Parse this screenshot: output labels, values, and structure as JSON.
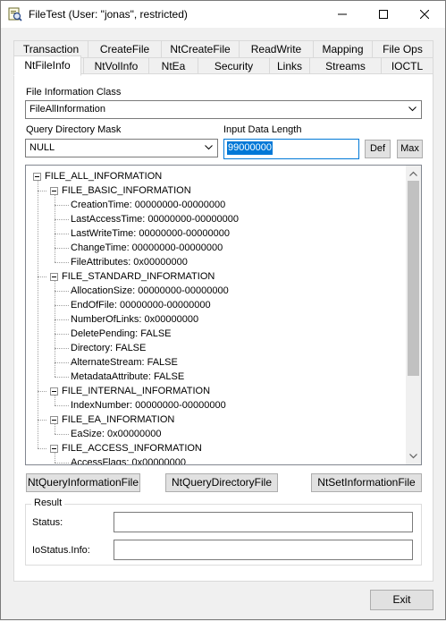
{
  "window": {
    "title": "FileTest (User: \"jonas\", restricted)"
  },
  "tabs_row1": [
    "Transaction",
    "CreateFile",
    "NtCreateFile",
    "ReadWrite",
    "Mapping",
    "File Ops"
  ],
  "tabs_row2": [
    "NtFileInfo",
    "NtVolInfo",
    "NtEa",
    "Security",
    "Links",
    "Streams",
    "IOCTL"
  ],
  "active_tab": "NtFileInfo",
  "form": {
    "info_class_label": "File Information Class",
    "info_class_value": "FileAllInformation",
    "query_mask_label": "Query Directory Mask",
    "query_mask_value": "NULL",
    "input_length_label": "Input Data Length",
    "input_length_value": "99000000",
    "def_label": "Def",
    "max_label": "Max"
  },
  "tree": [
    {
      "text": "FILE_ALL_INFORMATION",
      "level": 0,
      "expanded": true
    },
    {
      "text": "FILE_BASIC_INFORMATION",
      "level": 1,
      "expanded": true
    },
    {
      "text": "CreationTime: 00000000-00000000",
      "level": 2
    },
    {
      "text": "LastAccessTime: 00000000-00000000",
      "level": 2
    },
    {
      "text": "LastWriteTime: 00000000-00000000",
      "level": 2
    },
    {
      "text": "ChangeTime: 00000000-00000000",
      "level": 2
    },
    {
      "text": "FileAttributes: 0x00000000",
      "level": 2
    },
    {
      "text": "FILE_STANDARD_INFORMATION",
      "level": 1,
      "expanded": true
    },
    {
      "text": "AllocationSize: 00000000-00000000",
      "level": 2
    },
    {
      "text": "EndOfFile: 00000000-00000000",
      "level": 2
    },
    {
      "text": "NumberOfLinks: 0x00000000",
      "level": 2
    },
    {
      "text": "DeletePending: FALSE",
      "level": 2
    },
    {
      "text": "Directory: FALSE",
      "level": 2
    },
    {
      "text": "AlternateStream: FALSE",
      "level": 2
    },
    {
      "text": "MetadataAttribute: FALSE",
      "level": 2
    },
    {
      "text": "FILE_INTERNAL_INFORMATION",
      "level": 1,
      "expanded": true
    },
    {
      "text": "IndexNumber: 00000000-00000000",
      "level": 2
    },
    {
      "text": "FILE_EA_INFORMATION",
      "level": 1,
      "expanded": true
    },
    {
      "text": "EaSize: 0x00000000",
      "level": 2
    },
    {
      "text": "FILE_ACCESS_INFORMATION",
      "level": 1,
      "expanded": true
    },
    {
      "text": "AccessFlags: 0x00000000",
      "level": 2
    }
  ],
  "actions": {
    "query_info": "NtQueryInformationFile",
    "query_dir": "NtQueryDirectoryFile",
    "set_info": "NtSetInformationFile"
  },
  "result": {
    "title": "Result",
    "status_label": "Status:",
    "status_value": "",
    "iostatus_label": "IoStatus.Info:",
    "iostatus_value": ""
  },
  "exit_label": "Exit",
  "colors": {
    "accent": "#0078d7",
    "window_bg": "#f0f0f0",
    "panel_bg": "#ffffff"
  }
}
